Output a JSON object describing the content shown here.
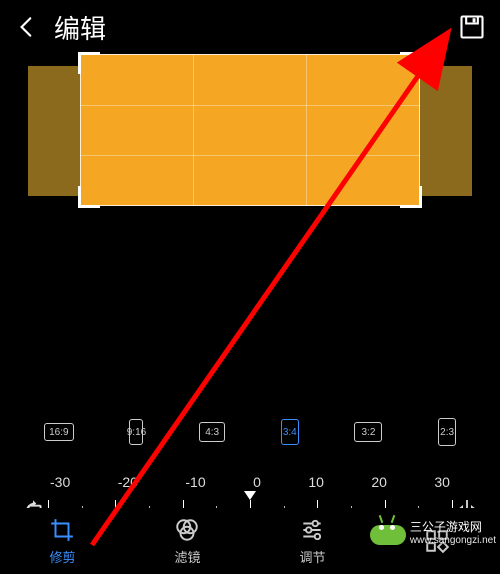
{
  "header": {
    "title": "编辑"
  },
  "ratios": [
    {
      "label": "16:9",
      "cls": "rb-169",
      "active": false
    },
    {
      "label": "9:16",
      "cls": "rb-916",
      "active": false
    },
    {
      "label": "4:3",
      "cls": "rb-43",
      "active": false
    },
    {
      "label": "3:4",
      "cls": "rb-34",
      "active": true
    },
    {
      "label": "3:2",
      "cls": "rb-32",
      "active": false
    },
    {
      "label": "2:3",
      "cls": "rb-23",
      "active": false
    }
  ],
  "angle": {
    "ticks": [
      "-30",
      "-20",
      "-10",
      "0",
      "10",
      "20",
      "30"
    ]
  },
  "tabs": [
    {
      "key": "crop",
      "label": "修剪",
      "active": true
    },
    {
      "key": "filter",
      "label": "滤镜",
      "active": false
    },
    {
      "key": "adjust",
      "label": "调节",
      "active": false
    },
    {
      "key": "more",
      "label": "",
      "active": false
    }
  ],
  "watermark": {
    "text": "三公子游戏网",
    "url": "www.sangongzi.net"
  }
}
